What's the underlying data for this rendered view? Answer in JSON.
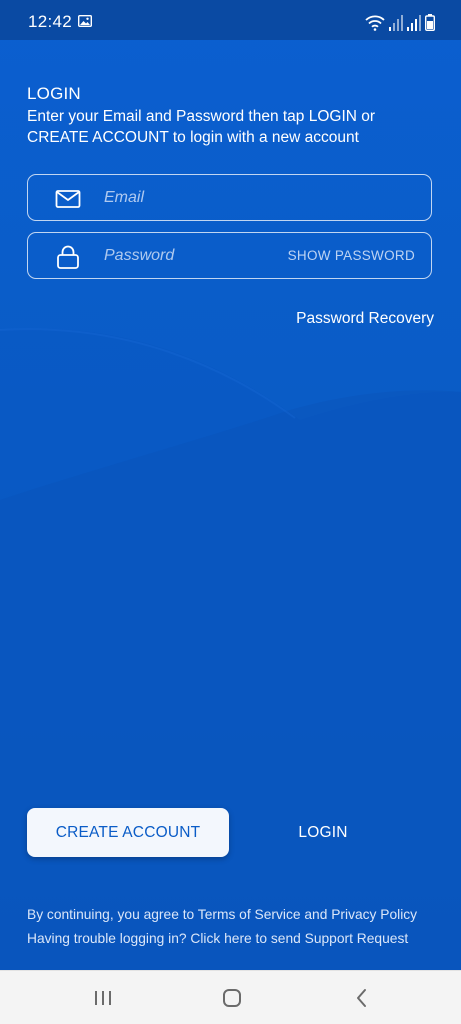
{
  "status_bar": {
    "time": "12:42",
    "icons": [
      "gallery-icon",
      "wifi-icon",
      "signal-icon",
      "signal-icon",
      "battery-icon"
    ]
  },
  "header": {
    "title": "LOGIN",
    "instructions": "Enter your Email and Password then tap LOGIN or CREATE ACCOUNT to login with a new account"
  },
  "form": {
    "email": {
      "placeholder": "Email",
      "value": "",
      "icon": "envelope-icon"
    },
    "password": {
      "placeholder": "Password",
      "value": "",
      "icon": "lock-icon",
      "toggle_label": "SHOW PASSWORD"
    },
    "recovery_link": "Password Recovery"
  },
  "actions": {
    "create_account_label": "CREATE ACCOUNT",
    "login_label": "LOGIN"
  },
  "footer": {
    "terms_text": "By continuing, you agree to Terms of Service and Privacy Policy",
    "support_text": "Having trouble logging in? Click here to send Support Request"
  },
  "nav_bar": {
    "icons": [
      "recent-apps-icon",
      "home-icon",
      "back-icon"
    ]
  },
  "colors": {
    "background": "#0a5cc7",
    "status_bar": "#0a4aa3",
    "button_light": "#f3f7fd",
    "nav_bar": "#f4f4f4"
  }
}
